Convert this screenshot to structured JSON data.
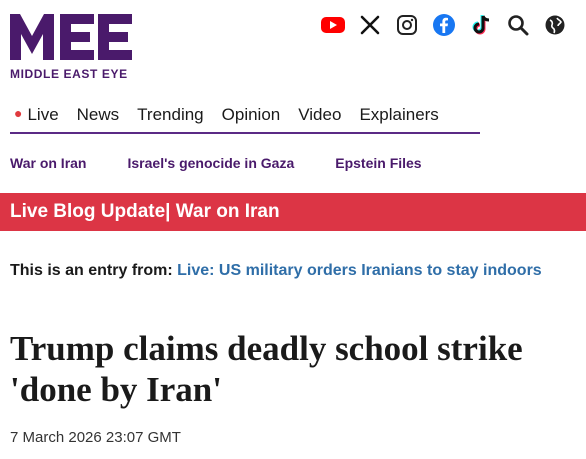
{
  "brand": {
    "logo_text": "MIDDLE EAST EYE",
    "color": "#4a1a6b"
  },
  "social_icons": [
    "youtube-icon",
    "x-icon",
    "instagram-icon",
    "facebook-icon",
    "tiktok-icon",
    "search-icon",
    "globe-icon"
  ],
  "main_nav": {
    "items": [
      {
        "label": "Live"
      },
      {
        "label": "News"
      },
      {
        "label": "Trending"
      },
      {
        "label": "Opinion"
      },
      {
        "label": "Video"
      },
      {
        "label": "Explainers"
      }
    ]
  },
  "sub_nav": {
    "items": [
      {
        "label": "War on Iran"
      },
      {
        "label": "Israel's genocide in Gaza"
      },
      {
        "label": "Epstein Files"
      }
    ]
  },
  "banner": {
    "text": "Live Blog Update| War on Iran",
    "color": "#dc3545"
  },
  "entry": {
    "prefix": "This is an entry from: ",
    "link": "Live: US military orders Iranians to stay indoors"
  },
  "article": {
    "headline": "Trump claims deadly school strike 'done by Iran'",
    "date": "7 March 2026 23:07 GMT"
  }
}
